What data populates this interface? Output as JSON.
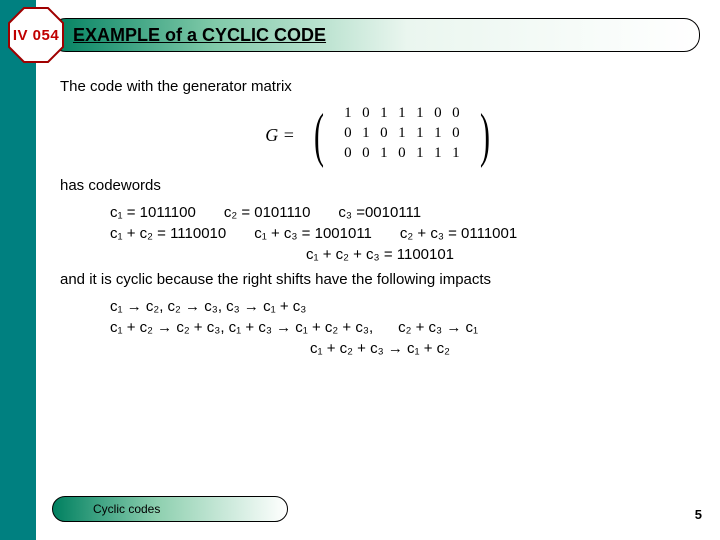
{
  "badge": "IV 054",
  "title": "EXAMPLE of a CYCLIC CODE",
  "intro": "The code with  the generator matrix",
  "matrix": {
    "label": "G =",
    "rows": [
      [
        "1",
        "0",
        "1",
        "1",
        "1",
        "0",
        "0"
      ],
      [
        "0",
        "1",
        "0",
        "1",
        "1",
        "1",
        "0"
      ],
      [
        "0",
        "0",
        "1",
        "0",
        "1",
        "1",
        "1"
      ]
    ]
  },
  "has_codewords": "has codewords",
  "codewords_row1": {
    "c1": "c₁ = 1011100",
    "c2": "c₂ = 0101110",
    "c3": "c₃ =0010111"
  },
  "codewords_row2": {
    "a": "c₁ + c₂ = 1110010",
    "b": "c₁ + c₃ = 1001011",
    "c": "c₂ + c₃ = 0111001"
  },
  "codewords_row3": "c₁ + c₂ + c₃ = 1100101",
  "cyclic_text": "and it is cyclic because the right shifts have the following impacts",
  "shifts_row1": "c₁ → c₂, c₂ → c₃, c₃ → c₁ + c₃",
  "shifts_row2a": "c₁ + c₂ → c₂ + c₃, c₁ + c₃ → c₁ + c₂ + c₃,",
  "shifts_row2b": "c₂ + c₃ → c₁",
  "shifts_row3": "c₁ + c₂ + c₃ → c₁ + c₂",
  "footer": "Cyclic codes",
  "page": "5"
}
